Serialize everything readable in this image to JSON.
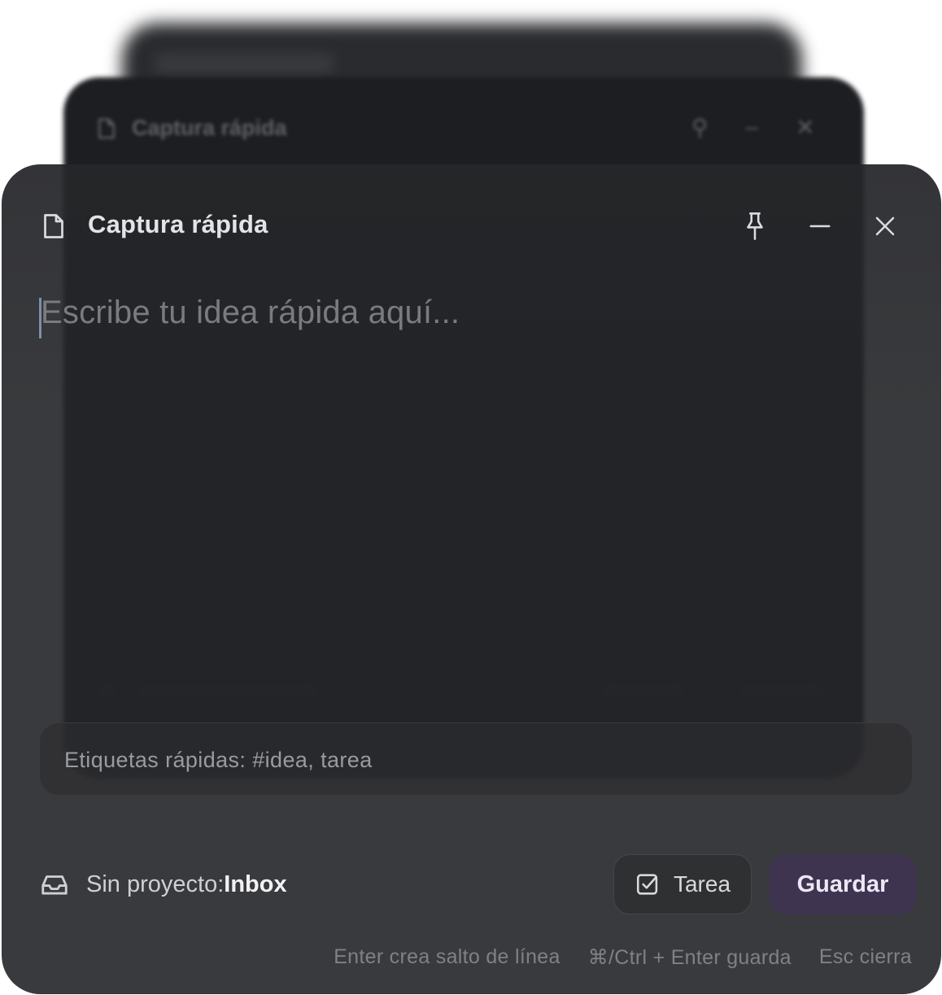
{
  "window": {
    "title": "Captura rápida",
    "icons": {
      "title": "note-icon",
      "pin": "pin-icon",
      "minimize": "minimize-icon",
      "close": "close-icon"
    }
  },
  "editor": {
    "placeholder": "Escribe tu idea rápida aquí..."
  },
  "tags": {
    "placeholder": "Etiquetas rápidas: #idea, tarea"
  },
  "footer": {
    "project_icon": "inbox-icon",
    "project_label": "Sin proyecto: ",
    "project_value": "Inbox",
    "task_button": {
      "icon": "checkbox-icon",
      "label": "Tarea"
    },
    "save_button": {
      "label": "Guardar"
    }
  },
  "hints": [
    "Enter crea salto de línea",
    "⌘/Ctrl + Enter guarda",
    "Esc cierra"
  ],
  "colors": {
    "window_bg": "#242528",
    "accent": "#3f3450",
    "text": "#e4e4e6",
    "muted": "#808186"
  }
}
